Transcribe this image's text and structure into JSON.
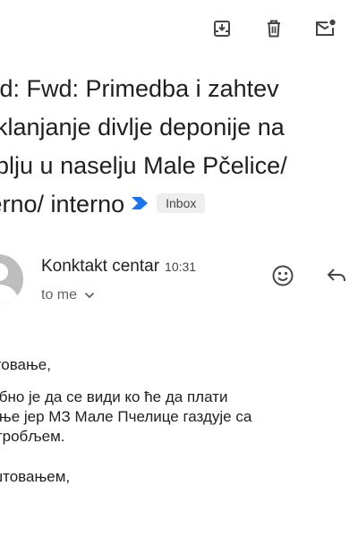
{
  "toolbar": {
    "archive_icon": "archive-icon",
    "delete_icon": "trash-icon",
    "mark_unread_icon": "mark-unread-icon"
  },
  "subject": {
    "lines": [
      "wd: Fwd: Primedba i zahtev",
      " uklanjanje divlje deponije na",
      "oblju u naselju Male Pčelice/",
      "terno/ interno"
    ],
    "importance_color": "#1a73e8",
    "label": "Inbox"
  },
  "sender": {
    "name": "Konktakt centar",
    "time": "10:31",
    "recipient": "to me",
    "avatar_color": "#bdbdbd"
  },
  "message": {
    "greeting": "штовање,",
    "body_lines": [
      "ребно је  да се види ко ће  да плати",
      "ћење јер МЗ Мале  Пчелице газдује  са",
      "м  гробљем."
    ],
    "closing": "оштовањем,"
  }
}
